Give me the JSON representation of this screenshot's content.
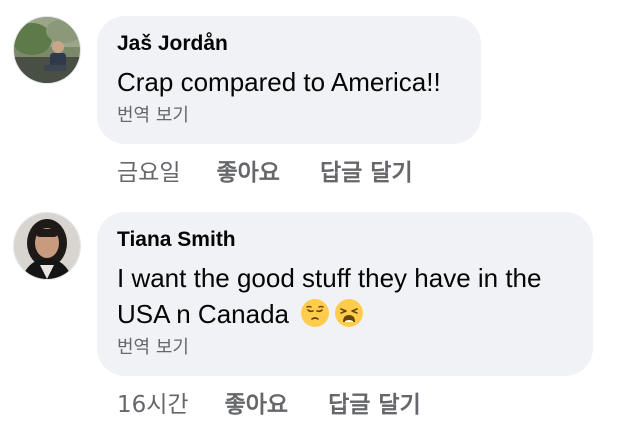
{
  "comments": [
    {
      "author": "Jaš Jordån",
      "text": "Crap compared to America!!",
      "translate_label": "번역 보기",
      "time": "금요일",
      "like_label": "좋아요",
      "reply_label": "답글 달기",
      "avatar_icon": "profile-photo-outdoor"
    },
    {
      "author": "Tiana Smith",
      "text_line1": "I want the good stuff they have in the",
      "text_line2": "USA n Canada",
      "emojis": [
        "pensive-face-emoji",
        "weary-face-emoji"
      ],
      "translate_label": "번역 보기",
      "time": "16시간",
      "like_label": "좋아요",
      "reply_label": "답글 달기",
      "avatar_icon": "profile-photo-woman"
    }
  ],
  "colors": {
    "bubble_bg": "#f0f2f5",
    "secondary_text": "#65676b",
    "primary_text": "#050505",
    "emoji_yellow": "#ffcc4d"
  }
}
